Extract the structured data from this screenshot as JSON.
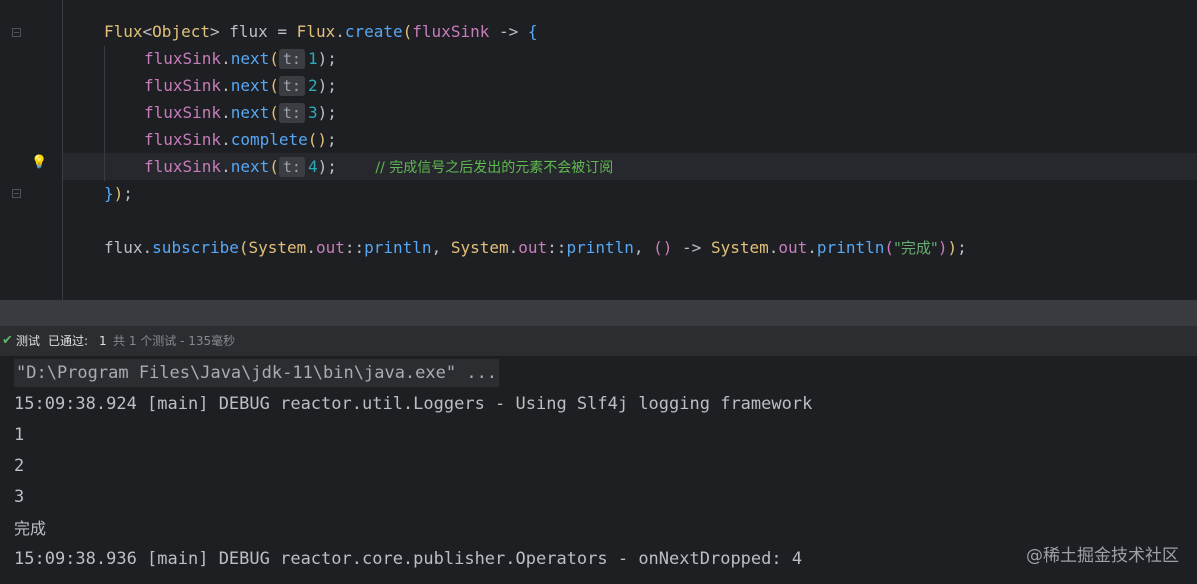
{
  "editor": {
    "line1": {
      "t1": "Flux",
      "t2": "<",
      "t3": "Object",
      "t4": ">",
      "t5": " flux = ",
      "t6": "Flux",
      "t7": ".",
      "t8": "create",
      "t9": "(",
      "t10": "fluxSink",
      "t11": " -> ",
      "t12": "{"
    },
    "next_calls": [
      {
        "obj": "fluxSink",
        "dot": ".",
        "method": "next",
        "open": "(",
        "hint": "t:",
        "value": "1",
        "close": ");"
      },
      {
        "obj": "fluxSink",
        "dot": ".",
        "method": "next",
        "open": "(",
        "hint": "t:",
        "value": "2",
        "close": ");"
      },
      {
        "obj": "fluxSink",
        "dot": ".",
        "method": "next",
        "open": "(",
        "hint": "t:",
        "value": "3",
        "close": ");"
      }
    ],
    "complete_line": {
      "obj": "fluxSink",
      "dot": ".",
      "method": "complete",
      "parens": "()",
      "semi": ";"
    },
    "last_next": {
      "obj": "fluxSink",
      "dot": ".",
      "method": "next",
      "open": "(",
      "hint": "t:",
      "value": "4",
      "close": ");",
      "comment": "// 完成信号之后发出的元素不会被订阅"
    },
    "close_line": {
      "brace": "}",
      "paren": ")",
      "semi": ";"
    },
    "subscribe_line": {
      "p1": "flux",
      "p2": ".",
      "p3": "subscribe",
      "p4": "(",
      "p5": "System",
      "p6": ".",
      "p7": "out",
      "p8": "::",
      "p9": "println",
      "p10": ", ",
      "p11": "System",
      "p12": ".",
      "p13": "out",
      "p14": "::",
      "p15": "println",
      "p16": ", ",
      "p17": "()",
      "p18": " -> ",
      "p19": "System",
      "p20": ".",
      "p21": "out",
      "p22": ".",
      "p23": "println",
      "p24": "(",
      "p25": "\"完成\"",
      "p26": ")",
      "p27": ")",
      "p28": ";"
    }
  },
  "test_bar": {
    "label": "测试",
    "passed": "已通过:",
    "count": "1",
    "rest": "共 1 个测试 - 135毫秒"
  },
  "console": {
    "lines": [
      "\"D:\\Program Files\\Java\\jdk-11\\bin\\java.exe\" ...",
      "15:09:38.924 [main] DEBUG reactor.util.Loggers - Using Slf4j logging framework",
      "1",
      "2",
      "3",
      "完成",
      "15:09:38.936 [main] DEBUG reactor.core.publisher.Operators - onNextDropped: 4"
    ]
  },
  "watermark": "@稀土掘金技术社区",
  "colors": {
    "editor_bg": "#1e1f22",
    "class": "#e2c07a",
    "method": "#56a8f5",
    "variable": "#c77dbb",
    "number": "#2aacb8",
    "comment": "#5fb950",
    "pass_check": "#5fb865"
  }
}
